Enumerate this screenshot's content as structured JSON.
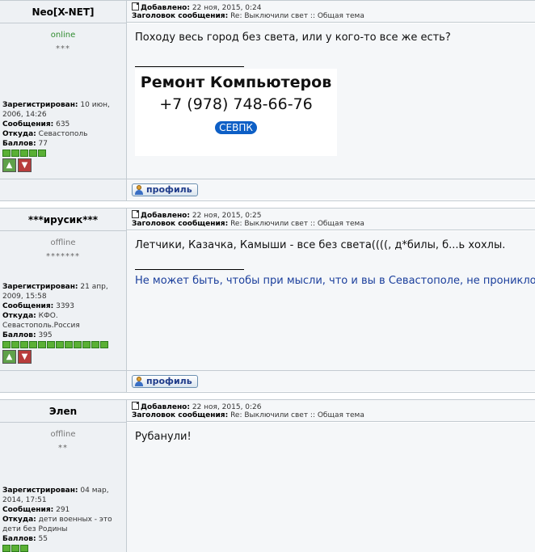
{
  "posts": [
    {
      "username": "Neo[X-NET]",
      "status": "online",
      "stars": "***",
      "added_label": "Добавлено:",
      "added_value": "22 ноя, 2015, 0:24",
      "subject_label": "Заголовок сообщения:",
      "subject_value": "Re: Выключили свет :: Общая тема",
      "message": "Походу весь город без света, или у кого-то все же есть?",
      "registered_label": "Зарегистрирован:",
      "registered_value": "10 июн, 2006, 14:26",
      "messages_label": "Сообщения:",
      "messages_value": "635",
      "from_label": "Откуда:",
      "from_value": "Севастополь",
      "points_label": "Баллов:",
      "points_value": "77",
      "level_count": 5,
      "signature_ad": {
        "title": "Ремонт Компьютеров",
        "phone": "+7 (978) 748-66-76",
        "badge": "СЕВПК"
      },
      "profile_label": "профиль"
    },
    {
      "username": "***ирусик***",
      "status": "offline",
      "stars": "*******",
      "added_label": "Добавлено:",
      "added_value": "22 ноя, 2015, 0:25",
      "subject_label": "Заголовок сообщения:",
      "subject_value": "Re: Выключили свет :: Общая тема",
      "message": "Летчики, Казачка, Камыши - все без света((((, д*билы, б...ь хохлы.",
      "signature_text": "Не может быть, чтобы при мысли, что и вы в Севастополе, не проникло",
      "registered_label": "Зарегистрирован:",
      "registered_value": "21 апр, 2009, 15:58",
      "messages_label": "Сообщения:",
      "messages_value": "3393",
      "from_label": "Откуда:",
      "from_value": "КФО. Севастополь.Россия",
      "points_label": "Баллов:",
      "points_value": "395",
      "level_count": 12,
      "profile_label": "профиль"
    },
    {
      "username": "Элеn",
      "status": "offline",
      "stars": "**",
      "added_label": "Добавлено:",
      "added_value": "22 ноя, 2015, 0:26",
      "subject_label": "Заголовок сообщения:",
      "subject_value": "Re: Выключили свет :: Общая тема",
      "message": "Рубанули!",
      "registered_label": "Зарегистрирован:",
      "registered_value": "04 мар, 2014, 17:51",
      "messages_label": "Сообщения:",
      "messages_value": "291",
      "from_label": "Откуда:",
      "from_value": "дети военных - это дети без Родины",
      "points_label": "Баллов:",
      "points_value": "55",
      "level_count": 3
    }
  ],
  "icons": {
    "post-icon": "document-icon",
    "thumb-up": "thumbs-up-icon",
    "thumb-down": "thumbs-down-icon",
    "profile": "user-icon"
  },
  "colors": {
    "online": "#2e8b2e",
    "signature": "#1a3e9c",
    "ad_badge": "#0d5fc6"
  }
}
